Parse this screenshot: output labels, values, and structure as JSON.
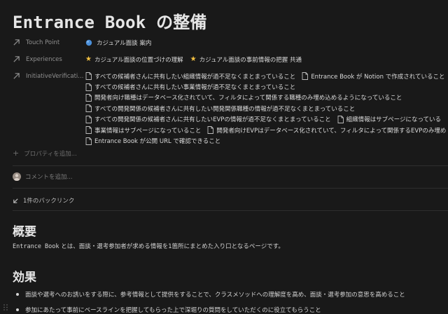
{
  "page": {
    "title": "Entrance Book の整備"
  },
  "properties": {
    "touch_point": {
      "label": "Touch Point",
      "value": "カジュアル面談 案内",
      "icon": "blue-bubble-icon"
    },
    "experiences": {
      "label": "Experiences",
      "items": [
        "カジュアル面談の位置づけの理解",
        "カジュアル面談の事前情報の把握 共通"
      ],
      "icon": "star-icon"
    },
    "initiative": {
      "label": "InitiativeVerificati...",
      "lines": [
        [
          "すべての候補者さんに共有したい組織情報が過不足なくまとまっていること",
          "Entrance Book が Notion で作成されていること"
        ],
        [
          "すべての候補者さんに共有したい事業情報が過不足なくまとまっていること"
        ],
        [
          "開発者向け職種はデータベース化されていて、フィルタによって関係する職種のみ埋め込めるようになっていること"
        ],
        [
          "すべての開発関係の候補者さんに共有したい開発関係職種の情報が過不足なくまとまっていること"
        ],
        [
          "すべての開発関係の候補者さんに共有したいEVPの情報が過不足なくまとまっていること",
          "組織情報はサブページになっている"
        ],
        [
          "事業情報はサブページになっていること",
          "開発者向けEVPはデータベース化されていて、フィルタによって関係するEVPのみ埋め"
        ],
        [
          "Entrance Book が公開 URL で確認できること"
        ]
      ]
    },
    "add_property": "プロパティを追加..."
  },
  "comment": {
    "placeholder": "コメントを追加..."
  },
  "backlinks": {
    "label": "1件のバックリンク"
  },
  "sections": {
    "overview": {
      "heading": "概要",
      "text_mono": "Entrance Book",
      "text_rest": " とは、面談・選考参加者が求める情報を1箇所にまとめた入り口となるページです。"
    },
    "effects": {
      "heading": "効果",
      "bullets": [
        "面談や選考へのお誘いをする際に、参考情報として提供をすることで、クラスメソッドへの理解度を高め、面談・選考参加の意思を高めること",
        "参加にあたって事前にベースラインを把握してもらった上で深堀りの質問をしていただくのに役立てもらうこと"
      ]
    }
  },
  "colors": {
    "background": "#191919",
    "text": "#d4d4d4",
    "muted": "#8f8f8f",
    "star": "#f5c242",
    "bubble": "#4a8fd9"
  }
}
